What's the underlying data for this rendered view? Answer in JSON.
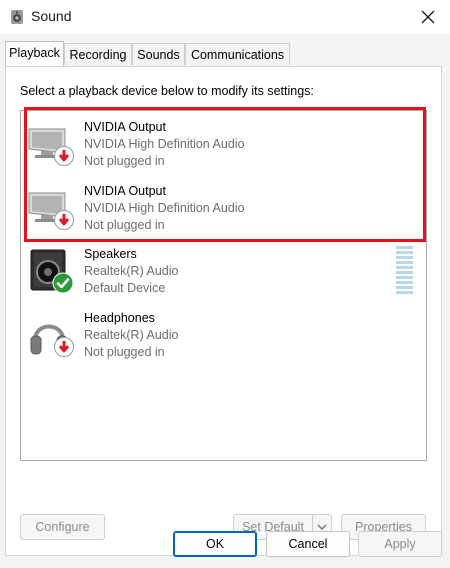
{
  "window": {
    "title": "Sound",
    "close_icon": "close-icon",
    "app_icon": "speaker-icon"
  },
  "tabs": [
    {
      "label": "Playback",
      "active": true
    },
    {
      "label": "Recording",
      "active": false
    },
    {
      "label": "Sounds",
      "active": false
    },
    {
      "label": "Communications",
      "active": false
    }
  ],
  "instruction": "Select a playback device below to modify its settings:",
  "devices": [
    {
      "name": "NVIDIA Output",
      "driver": "NVIDIA High Definition Audio",
      "status": "Not plugged in",
      "icon": "monitor-icon",
      "badge": "red-down-arrow-badge"
    },
    {
      "name": "NVIDIA Output",
      "driver": "NVIDIA High Definition Audio",
      "status": "Not plugged in",
      "icon": "monitor-icon",
      "badge": "red-down-arrow-badge"
    },
    {
      "name": "Speakers",
      "driver": "Realtek(R) Audio",
      "status": "Default Device",
      "icon": "speaker-icon",
      "badge": "green-check-badge"
    },
    {
      "name": "Headphones",
      "driver": "Realtek(R) Audio",
      "status": "Not plugged in",
      "icon": "headphones-icon",
      "badge": "red-down-arrow-badge"
    }
  ],
  "buttons": {
    "configure": "Configure",
    "set_default": "Set Default",
    "properties": "Properties",
    "ok": "OK",
    "cancel": "Cancel",
    "apply": "Apply"
  },
  "colors": {
    "highlight": "#e8101a",
    "primary_border": "#0067c0",
    "not_plugged_badge": "#d61f26",
    "default_badge": "#2b9a3a"
  }
}
